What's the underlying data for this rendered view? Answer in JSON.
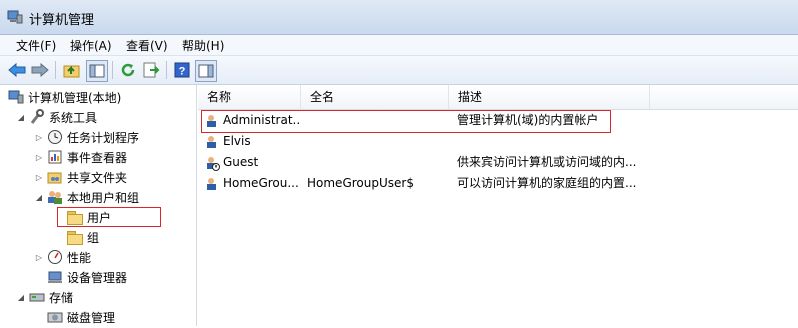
{
  "window": {
    "title": "计算机管理"
  },
  "menu": [
    "文件(F)",
    "操作(A)",
    "查看(V)",
    "帮助(H)"
  ],
  "toolbar_icons": [
    "back-arrow-icon",
    "forward-arrow-icon",
    "up-folder-icon",
    "show-hide-tree-icon",
    "refresh-icon",
    "export-list-icon",
    "help-icon",
    "properties-pane-icon"
  ],
  "tree": {
    "root": "计算机管理(本地)",
    "system_tools": "系统工具",
    "task_scheduler": "任务计划程序",
    "event_viewer": "事件查看器",
    "shared_folders": "共享文件夹",
    "local_users_groups": "本地用户和组",
    "users": "用户",
    "groups": "组",
    "performance": "性能",
    "device_manager": "设备管理器",
    "storage": "存储",
    "disk_management": "磁盘管理"
  },
  "columns": {
    "name": "名称",
    "fullname": "全名",
    "description": "描述"
  },
  "users": [
    {
      "name": "Administrat...",
      "fullname": "",
      "description": "管理计算机(域)的内置帐户"
    },
    {
      "name": "Elvis",
      "fullname": "",
      "description": ""
    },
    {
      "name": "Guest",
      "fullname": "",
      "description": "供来宾访问计算机或访问域的内..."
    },
    {
      "name": "HomeGrou...",
      "fullname": "HomeGroupUser$",
      "description": "可以访问计算机的家庭组的内置..."
    }
  ],
  "colors": {
    "highlight_border": "#d8262a",
    "selected_folder": "#f7da84"
  }
}
